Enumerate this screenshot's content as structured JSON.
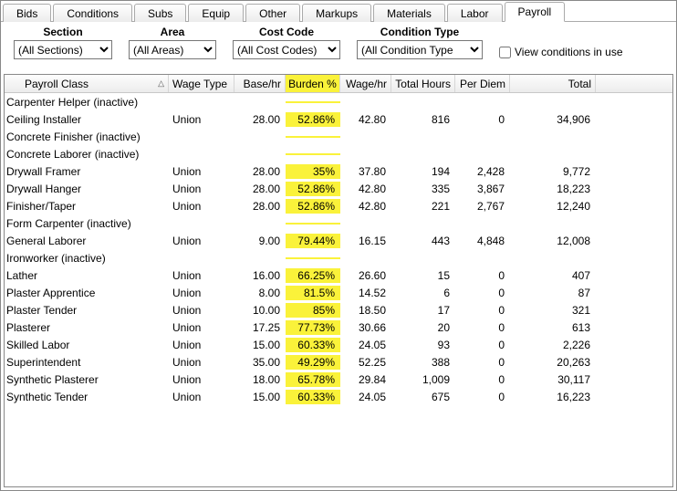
{
  "tabs": [
    "Bids",
    "Conditions",
    "Subs",
    "Equip",
    "Other",
    "Markups",
    "Materials",
    "Labor",
    "Payroll"
  ],
  "active_tab_index": 8,
  "filters": {
    "section": {
      "label": "Section",
      "value": "(All Sections)"
    },
    "area": {
      "label": "Area",
      "value": "(All Areas)"
    },
    "costcode": {
      "label": "Cost Code",
      "value": "(All Cost Codes)"
    },
    "condtype": {
      "label": "Condition Type",
      "value": "(All Condition Type"
    },
    "view_conditions": {
      "label": "View conditions in use",
      "checked": false
    }
  },
  "grid": {
    "columns": [
      "Payroll Class",
      "Wage Type",
      "Base/hr",
      "Burden %",
      "Wage/hr",
      "Total Hours",
      "Per Diem",
      "Total"
    ],
    "highlight_col_index": 3,
    "sort_col_index": 0
  },
  "chart_data": {
    "type": "table",
    "columns": [
      "Payroll Class",
      "Wage Type",
      "Base/hr",
      "Burden %",
      "Wage/hr",
      "Total Hours",
      "Per Diem",
      "Total"
    ],
    "highlight_column": "Burden %",
    "rows": [
      {
        "class": "Carpenter Helper (inactive)"
      },
      {
        "class": "Ceiling Installer",
        "wage_type": "Union",
        "base_hr": "28.00",
        "burden": "52.86%",
        "wage_hr": "42.80",
        "total_hours": "816",
        "per_diem": "0",
        "total": "34,906"
      },
      {
        "class": "Concrete Finisher (inactive)"
      },
      {
        "class": "Concrete Laborer (inactive)"
      },
      {
        "class": "Drywall Framer",
        "wage_type": "Union",
        "base_hr": "28.00",
        "burden": "35%",
        "wage_hr": "37.80",
        "total_hours": "194",
        "per_diem": "2,428",
        "total": "9,772"
      },
      {
        "class": "Drywall Hanger",
        "wage_type": "Union",
        "base_hr": "28.00",
        "burden": "52.86%",
        "wage_hr": "42.80",
        "total_hours": "335",
        "per_diem": "3,867",
        "total": "18,223"
      },
      {
        "class": "Finisher/Taper",
        "wage_type": "Union",
        "base_hr": "28.00",
        "burden": "52.86%",
        "wage_hr": "42.80",
        "total_hours": "221",
        "per_diem": "2,767",
        "total": "12,240"
      },
      {
        "class": "Form Carpenter (inactive)"
      },
      {
        "class": "General Laborer",
        "wage_type": "Union",
        "base_hr": "9.00",
        "burden": "79.44%",
        "wage_hr": "16.15",
        "total_hours": "443",
        "per_diem": "4,848",
        "total": "12,008"
      },
      {
        "class": "Ironworker (inactive)"
      },
      {
        "class": "Lather",
        "wage_type": "Union",
        "base_hr": "16.00",
        "burden": "66.25%",
        "wage_hr": "26.60",
        "total_hours": "15",
        "per_diem": "0",
        "total": "407"
      },
      {
        "class": "Plaster Apprentice",
        "wage_type": "Union",
        "base_hr": "8.00",
        "burden": "81.5%",
        "wage_hr": "14.52",
        "total_hours": "6",
        "per_diem": "0",
        "total": "87"
      },
      {
        "class": "Plaster Tender",
        "wage_type": "Union",
        "base_hr": "10.00",
        "burden": "85%",
        "wage_hr": "18.50",
        "total_hours": "17",
        "per_diem": "0",
        "total": "321"
      },
      {
        "class": "Plasterer",
        "wage_type": "Union",
        "base_hr": "17.25",
        "burden": "77.73%",
        "wage_hr": "30.66",
        "total_hours": "20",
        "per_diem": "0",
        "total": "613"
      },
      {
        "class": "Skilled Labor",
        "wage_type": "Union",
        "base_hr": "15.00",
        "burden": "60.33%",
        "wage_hr": "24.05",
        "total_hours": "93",
        "per_diem": "0",
        "total": "2,226"
      },
      {
        "class": "Superintendent",
        "wage_type": "Union",
        "base_hr": "35.00",
        "burden": "49.29%",
        "wage_hr": "52.25",
        "total_hours": "388",
        "per_diem": "0",
        "total": "20,263"
      },
      {
        "class": "Synthetic Plasterer",
        "wage_type": "Union",
        "base_hr": "18.00",
        "burden": "65.78%",
        "wage_hr": "29.84",
        "total_hours": "1,009",
        "per_diem": "0",
        "total": "30,117"
      },
      {
        "class": "Synthetic Tender",
        "wage_type": "Union",
        "base_hr": "15.00",
        "burden": "60.33%",
        "wage_hr": "24.05",
        "total_hours": "675",
        "per_diem": "0",
        "total": "16,223"
      }
    ]
  }
}
